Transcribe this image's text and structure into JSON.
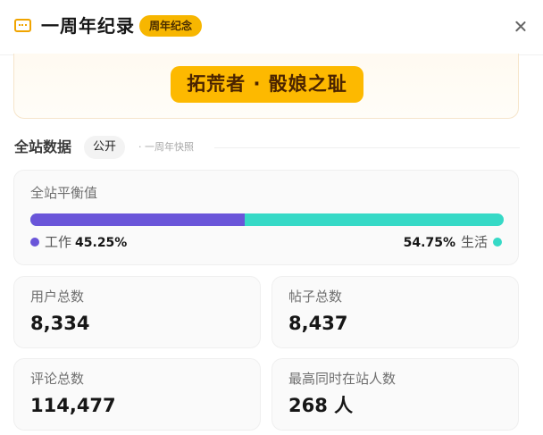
{
  "header": {
    "title": "一周年纪录",
    "badge": "周年纪念",
    "icon": "ticket-icon"
  },
  "banner": {
    "pill": "拓荒者 · 骰娘之耻"
  },
  "section": {
    "title": "全站数据",
    "tag": "公开",
    "note": "· 一周年快照"
  },
  "balance": {
    "label": "全站平衡值",
    "work_label": "工作",
    "work_pct": "45.25%",
    "life_pct": "54.75%",
    "life_label": "生活",
    "work_fraction": 0.4525,
    "work_color": "#6a55d9",
    "life_color": "#36d9c6"
  },
  "stats": [
    {
      "label": "用户总数",
      "value": "8,334"
    },
    {
      "label": "帖子总数",
      "value": "8,437"
    },
    {
      "label": "评论总数",
      "value": "114,477"
    },
    {
      "label": "最高同时在站人数",
      "value": "268 人"
    }
  ],
  "colors": {
    "accent": "#f7b600",
    "banner_pill": "#fdb900"
  }
}
